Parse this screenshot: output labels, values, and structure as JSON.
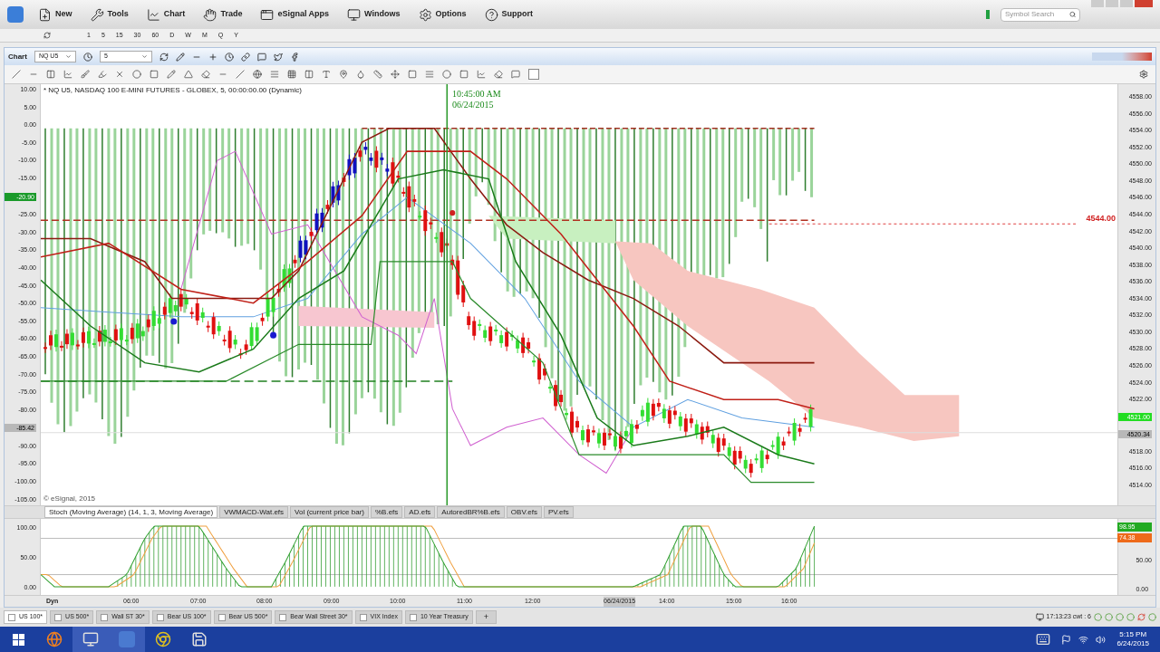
{
  "menu": {
    "items": [
      "New",
      "Tools",
      "Chart",
      "Trade",
      "eSignal Apps",
      "Windows",
      "Options",
      "Support"
    ],
    "search": {
      "placeholder": "Symbol Search"
    }
  },
  "intervals": [
    "1",
    "5",
    "15",
    "30",
    "60",
    "D",
    "W",
    "M",
    "Q",
    "Y"
  ],
  "chart_window": {
    "title": "Chart",
    "symbol": "NQ U5",
    "interval": "5"
  },
  "main_chart": {
    "title": "* NQ U5, NASDAQ 100 E-MINI FUTURES - GLOBEX, 5, 00:00:00.00 (Dynamic)",
    "cursor_time": "10:45:00 AM",
    "cursor_date": "06/24/2015",
    "line_label": "4544.00",
    "copyright": "© eSignal, 2015",
    "left_axis": [
      {
        "kind": "label",
        "text": "10.00"
      },
      {
        "kind": "label",
        "text": "5.00"
      },
      {
        "kind": "label",
        "text": "0.00"
      },
      {
        "kind": "label",
        "text": "-5.00"
      },
      {
        "kind": "label",
        "text": "-10.00"
      },
      {
        "kind": "label",
        "text": "-15.00"
      },
      {
        "kind": "marker",
        "text": "-20.90",
        "color": "#1a9a2a"
      },
      {
        "kind": "label",
        "text": "-25.00"
      },
      {
        "kind": "label",
        "text": "-30.00"
      },
      {
        "kind": "label",
        "text": "-35.00"
      },
      {
        "kind": "label",
        "text": "-40.00"
      },
      {
        "kind": "label",
        "text": "-45.00"
      },
      {
        "kind": "label",
        "text": "-50.00"
      },
      {
        "kind": "label",
        "text": "-55.00"
      },
      {
        "kind": "label",
        "text": "-60.00"
      },
      {
        "kind": "label",
        "text": "-65.00"
      },
      {
        "kind": "label",
        "text": "-70.00"
      },
      {
        "kind": "label",
        "text": "-75.00"
      },
      {
        "kind": "label",
        "text": "-80.00"
      },
      {
        "kind": "marker",
        "text": "-85.42",
        "color": "#b8b8b8"
      },
      {
        "kind": "label",
        "text": "-90.00"
      },
      {
        "kind": "label",
        "text": "-95.00"
      },
      {
        "kind": "label",
        "text": "-100.00"
      },
      {
        "kind": "label",
        "text": "-105.00"
      }
    ],
    "right_axis": [
      {
        "kind": "label",
        "text": "4558.00"
      },
      {
        "kind": "label",
        "text": "4556.00"
      },
      {
        "kind": "label",
        "text": "4554.00"
      },
      {
        "kind": "label",
        "text": "4552.00"
      },
      {
        "kind": "label",
        "text": "4550.00"
      },
      {
        "kind": "label",
        "text": "4548.00"
      },
      {
        "kind": "label",
        "text": "4546.00"
      },
      {
        "kind": "label",
        "text": "4544.00"
      },
      {
        "kind": "label",
        "text": "4542.00"
      },
      {
        "kind": "label",
        "text": "4540.00"
      },
      {
        "kind": "label",
        "text": "4538.00"
      },
      {
        "kind": "label",
        "text": "4536.00"
      },
      {
        "kind": "label",
        "text": "4534.00"
      },
      {
        "kind": "label",
        "text": "4532.00"
      },
      {
        "kind": "label",
        "text": "4530.00"
      },
      {
        "kind": "label",
        "text": "4528.00"
      },
      {
        "kind": "label",
        "text": "4526.00"
      },
      {
        "kind": "label",
        "text": "4524.00"
      },
      {
        "kind": "label",
        "text": "4522.00"
      },
      {
        "kind": "marker",
        "text": "4521.00",
        "color": "#22dd22"
      },
      {
        "kind": "marker",
        "text": "4520.34",
        "color": "#b8b8b8"
      },
      {
        "kind": "label",
        "text": "4518.00"
      },
      {
        "kind": "label",
        "text": "4516.00"
      },
      {
        "kind": "label",
        "text": "4514.00"
      }
    ]
  },
  "study_tabs": [
    {
      "label": "Stoch (Moving Average) (14, 1, 3, Moving Average)",
      "selected": true
    },
    {
      "label": "VWMACD-Wat.efs",
      "selected": false
    },
    {
      "label": "Vol (current price bar)",
      "selected": false
    },
    {
      "label": "%B.efs",
      "selected": false
    },
    {
      "label": "AD.efs",
      "selected": false
    },
    {
      "label": "AutoredBR%B.efs",
      "selected": false
    },
    {
      "label": "OBV.efs",
      "selected": false
    },
    {
      "label": "PV.efs",
      "selected": false
    }
  ],
  "stoch": {
    "left_axis": [
      "100.00",
      "50.00",
      "0.00"
    ],
    "right_axis": [
      "50.00",
      "0.00"
    ],
    "markers": [
      {
        "text": "98.95",
        "color": "#22aa22"
      },
      {
        "text": "74.38",
        "color": "#ee6a1a"
      }
    ]
  },
  "time_axis": {
    "dyn": "Dyn",
    "labels": [
      "06:00",
      "07:00",
      "08:00",
      "09:00",
      "10:00",
      "11:00",
      "12:00",
      "06/24/2015",
      "14:00",
      "15:00",
      "16:00"
    ]
  },
  "page_tabs": [
    {
      "label": "US 100*",
      "selected": true
    },
    {
      "label": "US 500*",
      "selected": false
    },
    {
      "label": "Wall ST 30*",
      "selected": false
    },
    {
      "label": "Bear US 100*",
      "selected": false
    },
    {
      "label": "Bear US 500*",
      "selected": false
    },
    {
      "label": "Bear Wall Street 30*",
      "selected": false
    },
    {
      "label": "VIX Index",
      "selected": false
    },
    {
      "label": "10 Year Treasury",
      "selected": false
    }
  ],
  "add_tab": "+",
  "status": "17:13:23 cwt : 6",
  "taskbar": {
    "time": "5:15 PM",
    "date": "6/24/2015"
  }
}
